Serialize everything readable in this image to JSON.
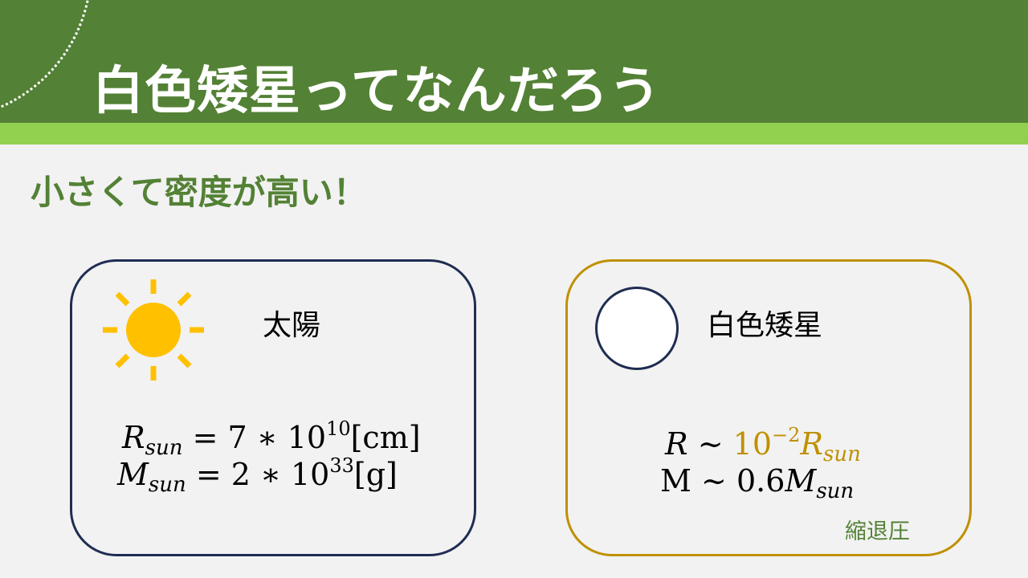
{
  "slide": {
    "title": "白色矮星ってなんだろう",
    "subtitle": "小さくて密度が高い！"
  },
  "sun_card": {
    "label": "太陽",
    "radius": {
      "symbol": "R",
      "sub": "sun",
      "rel": "=",
      "coef": "7",
      "op": "∗",
      "base": "10",
      "exp": "10",
      "unit": "[cm]"
    },
    "mass": {
      "symbol": "M",
      "sub": "sun",
      "rel": "=",
      "coef": "2",
      "op": "∗",
      "base": "10",
      "exp": "33",
      "unit": "[g]"
    }
  },
  "white_dwarf_card": {
    "label": "白色矮星",
    "radius": {
      "symbol": "R",
      "rel": "∼",
      "base": "10",
      "exp": "−2",
      "ref": "R",
      "ref_sub": "sun"
    },
    "mass": {
      "symbol": "M",
      "rel": "∼",
      "coef": "0.6",
      "ref": "M",
      "ref_sub": "sun"
    },
    "note": "縮退圧"
  },
  "colors": {
    "header": "#538135",
    "header_band": "#92d050",
    "background": "#f2f2f2",
    "sun": "#ffc000",
    "sun_card_border": "#1f2d52",
    "wd_card_border": "#bf9000",
    "accent_text": "#bf9000"
  },
  "icons": {
    "sun": "sun-icon",
    "white_dwarf": "white-dwarf-circle-icon"
  }
}
